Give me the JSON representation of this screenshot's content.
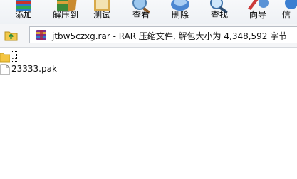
{
  "toolbar": {
    "items": [
      {
        "label": "添加",
        "icon": "add-archive-icon"
      },
      {
        "label": "解压到",
        "icon": "extract-to-icon"
      },
      {
        "label": "测试",
        "icon": "test-icon"
      },
      {
        "label": "查看",
        "icon": "view-icon"
      },
      {
        "label": "删除",
        "icon": "delete-icon"
      },
      {
        "label": "查找",
        "icon": "find-icon"
      },
      {
        "label": "向导",
        "icon": "wizard-icon"
      },
      {
        "label": "信",
        "icon": "info-icon"
      }
    ]
  },
  "address": {
    "text": "jtbw5czxg.rar - RAR 压缩文件, 解包大小为 4,348,592 字节",
    "icon": "rar-archive-icon",
    "up_icon": "up-folder-icon"
  },
  "files": [
    {
      "name": "..",
      "icon": "parent-folder-icon"
    },
    {
      "name": "23333.pak",
      "icon": "file-icon"
    }
  ],
  "colors": {
    "toolbar_bg": "#f3f5f8",
    "folder": "#f4c542",
    "rar_red": "#b0243a"
  }
}
